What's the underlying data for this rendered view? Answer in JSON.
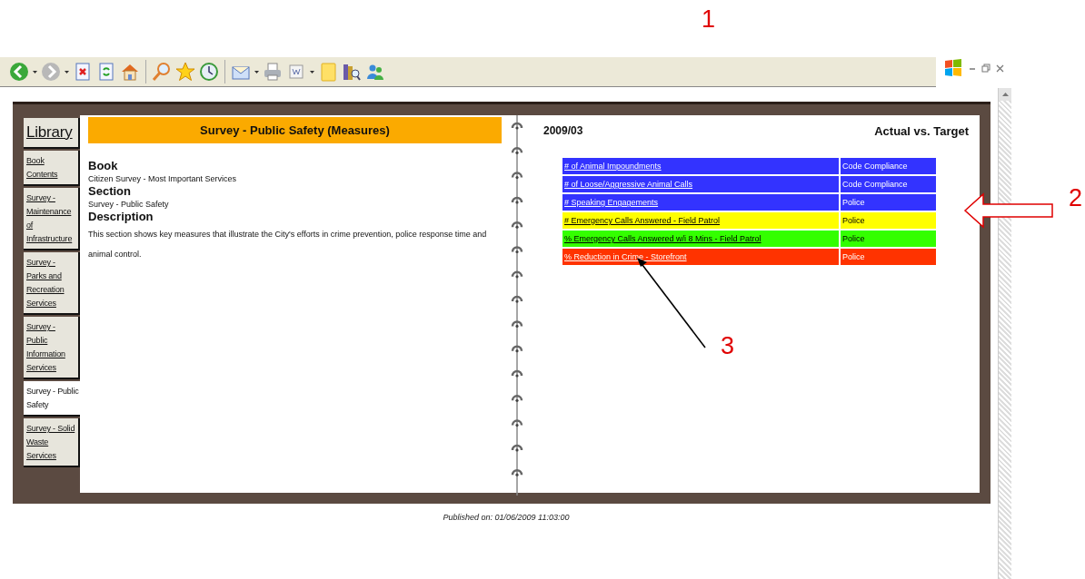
{
  "callouts": [
    {
      "label": "1"
    },
    {
      "label": "2"
    },
    {
      "label": "3"
    }
  ],
  "library": {
    "title": "Library",
    "tabs": [
      {
        "label": "Book Contents",
        "selected": false
      },
      {
        "label": "Survey - Maintenance of Infrastructure",
        "selected": false
      },
      {
        "label": "Survey - Parks and Recreation Services",
        "selected": false
      },
      {
        "label": "Survey - Public Information Services",
        "selected": false
      },
      {
        "label": "Survey - Public Safety",
        "selected": true
      },
      {
        "label": "Survey - Solid Waste Services",
        "selected": false
      }
    ]
  },
  "header": "Survey - Public Safety (Measures)",
  "details": [
    {
      "heading": "Book",
      "text": "Citizen Survey - Most Important Services"
    },
    {
      "heading": "Section",
      "text": "Survey - Public Safety"
    },
    {
      "heading": "Description",
      "text": "This section shows key measures that illustrate the City's efforts in crime prevention, police response time and animal control."
    }
  ],
  "period": "2009/03",
  "view": "Actual vs. Target",
  "measures": [
    {
      "name": "# of Animal Impoundments",
      "department": "Code Compliance",
      "color": "#3333ff"
    },
    {
      "name": "# of Loose/Aggressive Animal Calls",
      "department": "Code Compliance",
      "color": "#3333ff"
    },
    {
      "name": "# Speaking Engagements",
      "department": "Police",
      "color": "#3333ff"
    },
    {
      "name": "# Emergency Calls Answered - Field Patrol",
      "department": "Police",
      "color": "#ffff00"
    },
    {
      "name": "% Emergency Calls Answered w/i 8 Mins - Field Patrol",
      "department": "Police",
      "color": "#33ff00"
    },
    {
      "name": "% Reduction in Crime - Storefront",
      "department": "Police",
      "color": "#ff3300"
    }
  ],
  "published": "Published on: 01/06/2009 11:03:00"
}
